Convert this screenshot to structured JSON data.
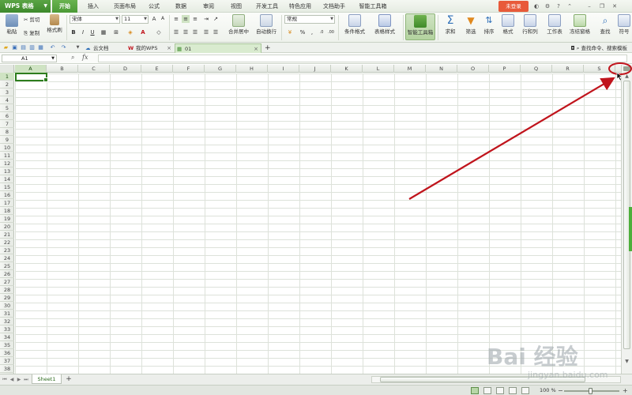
{
  "app": {
    "logo": "WPS 表格",
    "login_label": "未登录"
  },
  "menu": {
    "tabs": [
      {
        "label": "开始",
        "active": true
      },
      {
        "label": "插入"
      },
      {
        "label": "页面布局"
      },
      {
        "label": "公式"
      },
      {
        "label": "数据"
      },
      {
        "label": "审阅"
      },
      {
        "label": "视图"
      },
      {
        "label": "开发工具"
      },
      {
        "label": "特色应用"
      },
      {
        "label": "文档助手"
      },
      {
        "label": "智能工具箱"
      }
    ]
  },
  "ribbon": {
    "paste": "粘贴",
    "cut": "剪切",
    "copy": "复制",
    "format_painter": "格式刷",
    "font_name": "宋体",
    "font_size": "11",
    "bold": "B",
    "italic": "I",
    "underline": "U",
    "merge_center": "合并居中",
    "wrap_text": "自动换行",
    "number_format": "常规",
    "percent": "%",
    "conditional_format": "条件格式",
    "table_style": "表格样式",
    "smart_toolbox": "智能工具箱",
    "sum": "求和",
    "filter": "筛选",
    "sort": "排序",
    "format": "格式",
    "rows_cols": "行和列",
    "worksheet": "工作表",
    "freeze": "冻结窗格",
    "find": "查找",
    "more": "符号"
  },
  "doc_tabs": {
    "items": [
      {
        "label": "云文档"
      },
      {
        "label": "我的WPS"
      },
      {
        "label": "01",
        "active": true
      }
    ],
    "add": "+",
    "search_cmd": "查找命令、搜索模板"
  },
  "formula_bar": {
    "cell_ref": "A1",
    "fx": "fx"
  },
  "grid": {
    "columns": [
      "A",
      "B",
      "C",
      "D",
      "E",
      "F",
      "G",
      "H",
      "I",
      "J",
      "K",
      "L",
      "M",
      "N",
      "O",
      "P",
      "Q",
      "R",
      "S"
    ],
    "rows": [
      "1",
      "2",
      "3",
      "4",
      "5",
      "6",
      "7",
      "8",
      "9",
      "10",
      "11",
      "12",
      "13",
      "14",
      "15",
      "16",
      "17",
      "18",
      "19",
      "20",
      "21",
      "22",
      "23",
      "24",
      "25",
      "26",
      "27",
      "28",
      "29",
      "30",
      "31",
      "32",
      "33",
      "34",
      "35",
      "36",
      "37",
      "38"
    ],
    "selected_column": "A",
    "selected_row": "1"
  },
  "sheets": {
    "tabs": [
      "Sheet1"
    ],
    "add": "+"
  },
  "status": {
    "zoom": "100 %",
    "zoom_minus": "−",
    "zoom_plus": "+"
  },
  "colors": {
    "accent": "#4b9a36",
    "annotation": "#c0141c"
  },
  "watermark": {
    "brand": "Bai 经验",
    "url": "jingyan.baidu.com"
  }
}
